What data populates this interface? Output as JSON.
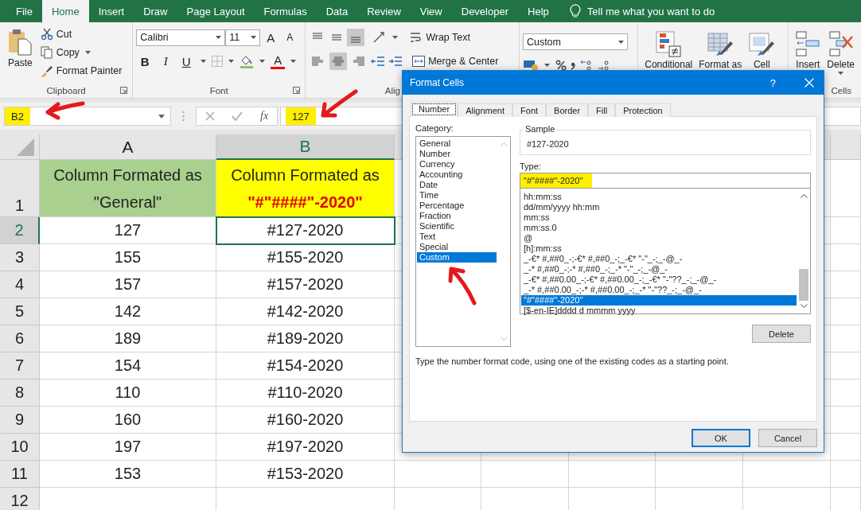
{
  "menu_tabs": [
    {
      "label": "File",
      "selected": false
    },
    {
      "label": "Home",
      "selected": true
    },
    {
      "label": "Insert",
      "selected": false
    },
    {
      "label": "Draw",
      "selected": false
    },
    {
      "label": "Page Layout",
      "selected": false
    },
    {
      "label": "Formulas",
      "selected": false
    },
    {
      "label": "Data",
      "selected": false
    },
    {
      "label": "Review",
      "selected": false
    },
    {
      "label": "View",
      "selected": false
    },
    {
      "label": "Developer",
      "selected": false
    },
    {
      "label": "Help",
      "selected": false
    }
  ],
  "tell_me": "Tell me what you want to do",
  "ribbon": {
    "clipboard": {
      "paste": "Paste",
      "cut": "Cut",
      "copy": "Copy",
      "format_painter": "Format Painter",
      "label": "Clipboard"
    },
    "font": {
      "name": "Calibri",
      "size": "11",
      "grow": "A",
      "shrink": "A",
      "bold": "B",
      "italic": "I",
      "underline": "U",
      "font_color": "A",
      "label": "Font"
    },
    "alignment": {
      "vertical_align": [
        {
          "selected": false
        },
        {
          "selected": false
        },
        {
          "selected": true
        }
      ],
      "horizontal_align": [
        {
          "selected": false
        },
        {
          "selected": true
        },
        {
          "selected": false
        }
      ],
      "wrap": "Wrap Text",
      "merge": "Merge & Center",
      "label": "Alig"
    },
    "number": {
      "format": "Custom"
    },
    "styles": [
      "Conditional",
      "Format as",
      "Cell"
    ],
    "cells": {
      "insert": "Insert",
      "delete": "Delete",
      "label": "Cells"
    }
  },
  "formula_bar": {
    "name_box": "B2",
    "fx": "fx",
    "formula": "127"
  },
  "sheet": {
    "columns": [
      {
        "letter": "A",
        "selected": false
      },
      {
        "letter": "B",
        "selected": true
      }
    ],
    "header_row": {
      "number": "1",
      "cells": [
        {
          "kind": "plain",
          "title": "Column Formated as",
          "format": "\"General\""
        },
        {
          "kind": "highlighted",
          "title": "Column Formated as",
          "format": "\"#\"####\"-2020\""
        }
      ]
    },
    "rows": [
      {
        "number": "2",
        "selected": true,
        "a": "127",
        "b": "#127-2020"
      },
      {
        "number": "3",
        "selected": false,
        "a": "155",
        "b": "#155-2020"
      },
      {
        "number": "4",
        "selected": false,
        "a": "157",
        "b": "#157-2020"
      },
      {
        "number": "5",
        "selected": false,
        "a": "142",
        "b": "#142-2020"
      },
      {
        "number": "6",
        "selected": false,
        "a": "189",
        "b": "#189-2020"
      },
      {
        "number": "7",
        "selected": false,
        "a": "154",
        "b": "#154-2020"
      },
      {
        "number": "8",
        "selected": false,
        "a": "110",
        "b": "#110-2020"
      },
      {
        "number": "9",
        "selected": false,
        "a": "160",
        "b": "#160-2020"
      },
      {
        "number": "10",
        "selected": false,
        "a": "197",
        "b": "#197-2020"
      },
      {
        "number": "11",
        "selected": false,
        "a": "153",
        "b": "#153-2020"
      }
    ],
    "empty_rows": [
      "12"
    ]
  },
  "dialog": {
    "title": "Format Cells",
    "help": "?",
    "tabs": [
      {
        "label": "Number",
        "selected": true
      },
      {
        "label": "Alignment",
        "selected": false
      },
      {
        "label": "Font",
        "selected": false
      },
      {
        "label": "Border",
        "selected": false
      },
      {
        "label": "Fill",
        "selected": false
      },
      {
        "label": "Protection",
        "selected": false
      }
    ],
    "category_label": "Category:",
    "categories": [
      {
        "label": "General",
        "selected": false
      },
      {
        "label": "Number",
        "selected": false
      },
      {
        "label": "Currency",
        "selected": false
      },
      {
        "label": "Accounting",
        "selected": false
      },
      {
        "label": "Date",
        "selected": false
      },
      {
        "label": "Time",
        "selected": false
      },
      {
        "label": "Percentage",
        "selected": false
      },
      {
        "label": "Fraction",
        "selected": false
      },
      {
        "label": "Scientific",
        "selected": false
      },
      {
        "label": "Text",
        "selected": false
      },
      {
        "label": "Special",
        "selected": false
      },
      {
        "label": "Custom",
        "selected": true
      }
    ],
    "sample_label": "Sample",
    "sample": "#127-2020",
    "type_label": "Type:",
    "type_value": "\"#\"####\"-2020\"",
    "formats": [
      {
        "code": "hh:mm:ss",
        "selected": false
      },
      {
        "code": "dd/mm/yyyy hh:mm",
        "selected": false
      },
      {
        "code": "mm:ss",
        "selected": false
      },
      {
        "code": "mm:ss.0",
        "selected": false
      },
      {
        "code": "@",
        "selected": false
      },
      {
        "code": "[h]:mm:ss",
        "selected": false
      },
      {
        "code": "_-€* #,##0_-;-€* #,##0_-;_-€* \"-\"_-;_-@_-",
        "selected": false
      },
      {
        "code": "_-* #,##0_-;-* #,##0_-;_-* \"-\"_-;_-@_-",
        "selected": false
      },
      {
        "code": "_-€* #,##0.00_-;-€* #,##0.00_-;_-€* \"-\"??_-;_-@_-",
        "selected": false
      },
      {
        "code": "_-* #,##0.00_-;-* #,##0.00_-;_-* \"-\"??_-;_-@_-",
        "selected": false
      },
      {
        "code": "\"#\"####\"-2020\"",
        "selected": true
      },
      {
        "code": "[$-en-IE]dddd d mmmm yyyy",
        "selected": false
      }
    ],
    "delete": "Delete",
    "description": "Type the number format code, using one of the existing codes as a starting point.",
    "ok": "OK",
    "cancel": "Cancel"
  }
}
